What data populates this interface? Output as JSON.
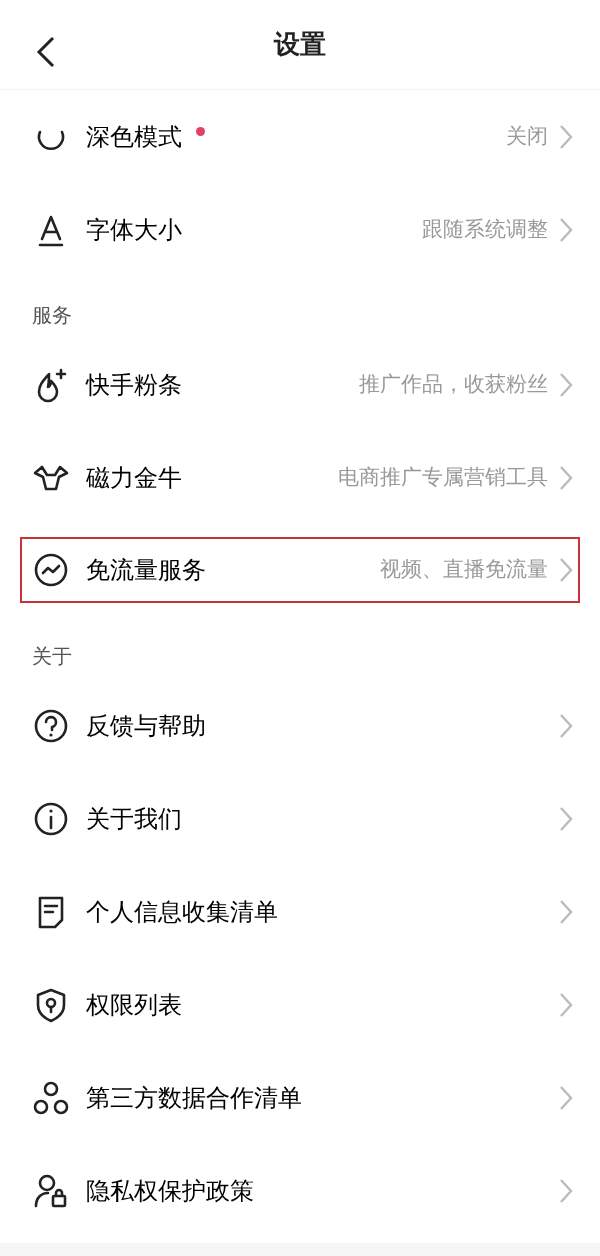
{
  "header": {
    "title": "设置"
  },
  "sections": [
    {
      "items": [
        {
          "kind": "moon",
          "label": "深色模式",
          "dot": true,
          "value": "关闭",
          "highlighted": false
        },
        {
          "kind": "font",
          "label": "字体大小",
          "dot": false,
          "value": "跟随系统调整",
          "highlighted": false
        }
      ]
    },
    {
      "title": "服务",
      "items": [
        {
          "kind": "flame",
          "label": "快手粉条",
          "dot": false,
          "value": "推广作品，收获粉丝",
          "highlighted": false
        },
        {
          "kind": "bull",
          "label": "磁力金牛",
          "dot": false,
          "value": "电商推广专属营销工具",
          "highlighted": false
        },
        {
          "kind": "pulse",
          "label": "免流量服务",
          "dot": false,
          "value": "视频、直播免流量",
          "highlighted": true
        }
      ]
    },
    {
      "title": "关于",
      "items": [
        {
          "kind": "help",
          "label": "反馈与帮助",
          "dot": false,
          "highlighted": false
        },
        {
          "kind": "info",
          "label": "关于我们",
          "dot": false,
          "highlighted": false
        },
        {
          "kind": "doc",
          "label": "个人信息收集清单",
          "dot": false,
          "highlighted": false
        },
        {
          "kind": "shield",
          "label": "权限列表",
          "dot": false,
          "highlighted": false
        },
        {
          "kind": "share",
          "label": "第三方数据合作清单",
          "dot": false,
          "highlighted": false
        },
        {
          "kind": "user",
          "label": "隐私权保护政策",
          "dot": false,
          "highlighted": false
        }
      ]
    }
  ]
}
